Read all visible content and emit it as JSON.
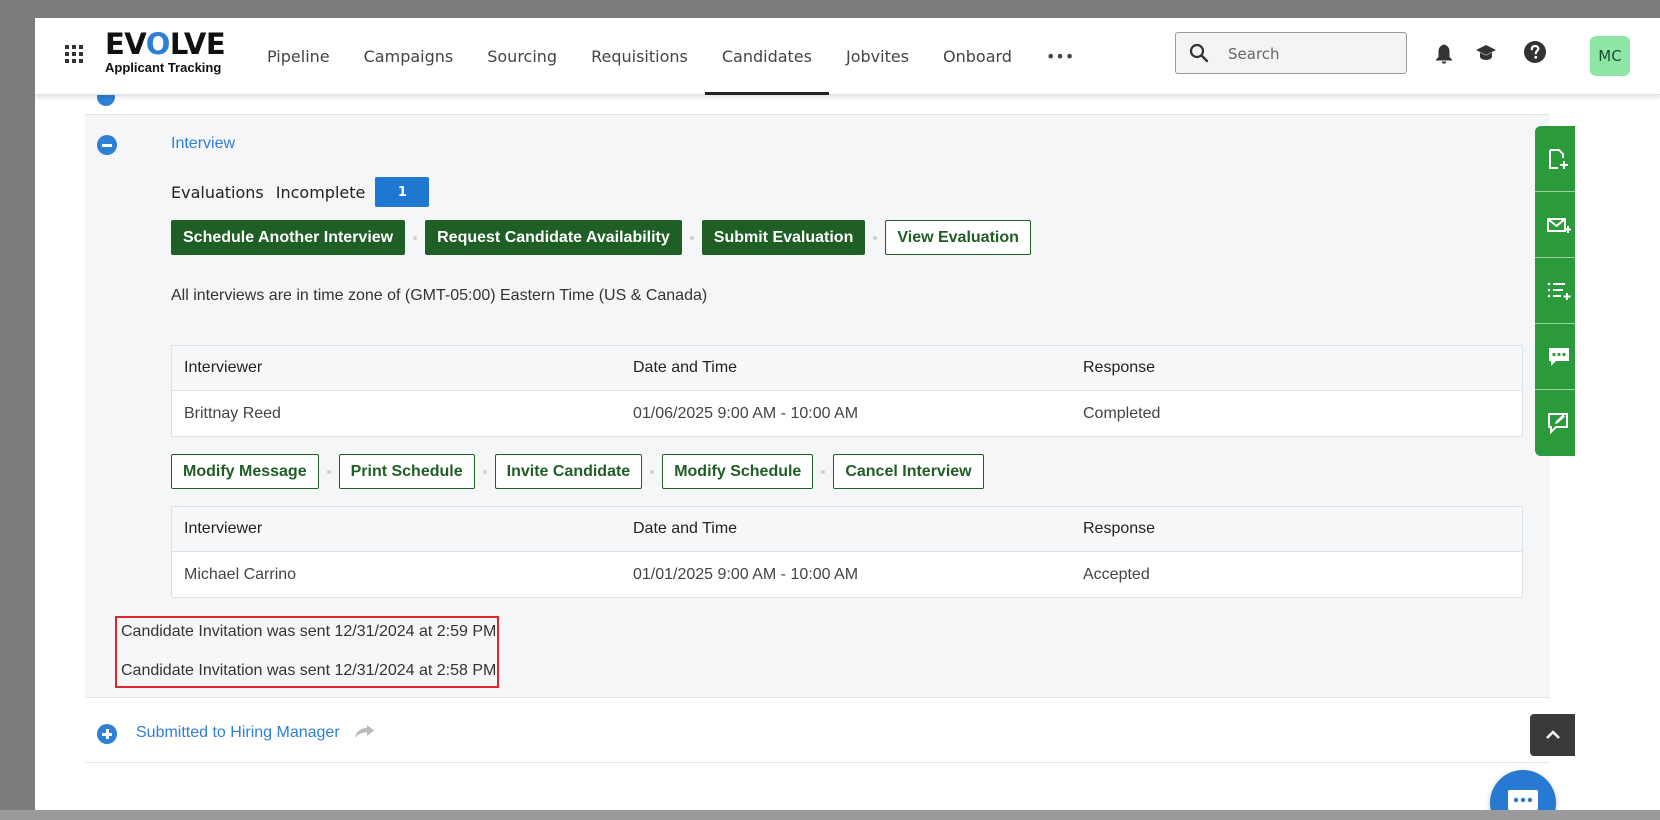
{
  "app": {
    "logo_main_prefix": "EV",
    "logo_main_o": "O",
    "logo_main_suffix": "LVE",
    "logo_sub": "Applicant Tracking"
  },
  "nav": {
    "items": [
      "Pipeline",
      "Campaigns",
      "Sourcing",
      "Requisitions",
      "Candidates",
      "Jobvites",
      "Onboard",
      "•••"
    ],
    "active": "Candidates"
  },
  "search": {
    "placeholder": "Search"
  },
  "header_icons": [
    "bell-icon",
    "graduation-cap-icon",
    "help-icon"
  ],
  "user": {
    "initials": "MC"
  },
  "interview_section": {
    "title": "Interview",
    "evaluations_label": "Evaluations",
    "incomplete_label": "Incomplete",
    "incomplete_count": "1",
    "actions": {
      "schedule_another": "Schedule Another Interview",
      "request_availability": "Request Candidate Availability",
      "submit_evaluation": "Submit Evaluation",
      "view_evaluation": "View Evaluation"
    },
    "timezone_note": "All interviews are in time zone of (GMT-05:00) Eastern Time (US & Canada)",
    "columns": {
      "interviewer": "Interviewer",
      "datetime": "Date and Time",
      "response": "Response"
    },
    "schedule1": {
      "interviewer": "Brittnay Reed",
      "datetime": "01/06/2025 9:00 AM - 10:00 AM",
      "response": "Completed"
    },
    "schedule_actions": {
      "modify_message": "Modify Message",
      "print_schedule": "Print Schedule",
      "invite_candidate": "Invite Candidate",
      "modify_schedule": "Modify Schedule",
      "cancel_interview": "Cancel Interview"
    },
    "schedule2": {
      "interviewer": "Michael Carrino",
      "datetime": "01/01/2025 9:00 AM - 10:00 AM",
      "response": "Accepted"
    },
    "notes": [
      "Candidate Invitation was sent 12/31/2024 at 2:59 PM",
      "Candidate Invitation was sent 12/31/2024 at 2:58 PM"
    ]
  },
  "next_section": {
    "title": "Submitted to Hiring Manager"
  },
  "colors": {
    "brand_green": "#1f5e25",
    "rail_green": "#2a9a3b",
    "link_blue": "#2e7fd6",
    "badge_blue": "#1f77d2",
    "highlight_red": "#e0262b",
    "avatar_green": "#8ee6a6"
  },
  "rail_icons": [
    "add-document-icon",
    "compose-email-icon",
    "add-list-icon",
    "chat-icon",
    "edit-note-icon"
  ]
}
